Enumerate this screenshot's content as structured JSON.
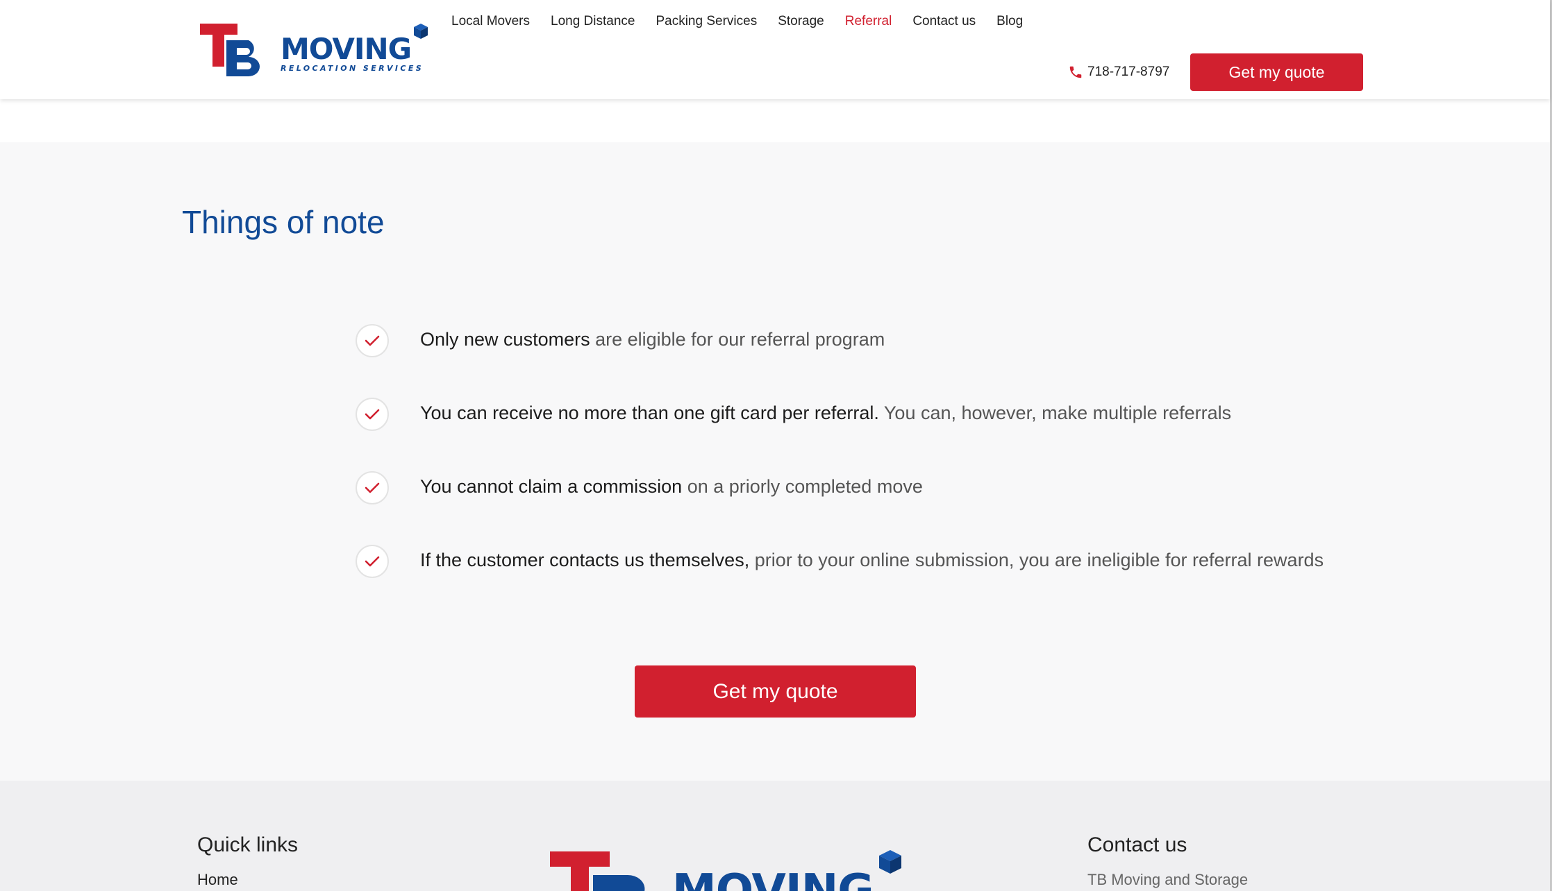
{
  "header": {
    "brand": "MOVING",
    "brand_tagline": "RELOCATION SERVICES",
    "nav": [
      {
        "label": "Local Movers"
      },
      {
        "label": "Long Distance"
      },
      {
        "label": "Packing Services"
      },
      {
        "label": "Storage"
      },
      {
        "label": "Referral",
        "active": true
      },
      {
        "label": "Contact us"
      },
      {
        "label": "Blog"
      }
    ],
    "phone": "718-717-8797",
    "quote_button": "Get my quote"
  },
  "notes_section": {
    "title": "Things of note",
    "items": [
      {
        "strong": "Only new customers",
        "rest": " are eligible for our referral program"
      },
      {
        "strong": "You can receive no more than one gift card per referral.",
        "rest": " You can, however, make multiple referrals"
      },
      {
        "strong": "You cannot claim a commission",
        "rest": " on a priorly completed move"
      },
      {
        "strong": "If the customer contacts us themselves,",
        "rest": " prior to your online submission, you are ineligible for referral rewards"
      }
    ],
    "quote_button": "Get my quote"
  },
  "footer": {
    "quick_links_heading": "Quick links",
    "quick_links": [
      {
        "label": "Home"
      }
    ],
    "brand": "MOVING",
    "contact_heading": "Contact us",
    "company_name": "TB Moving and Storage"
  },
  "colors": {
    "accent_red": "#d1202f",
    "brand_blue": "#114a96",
    "section_bg": "#f8f8f9",
    "footer_bg": "#efeff1"
  },
  "icons": {
    "phone": "phone-icon",
    "check": "check-icon",
    "box": "box-icon"
  }
}
